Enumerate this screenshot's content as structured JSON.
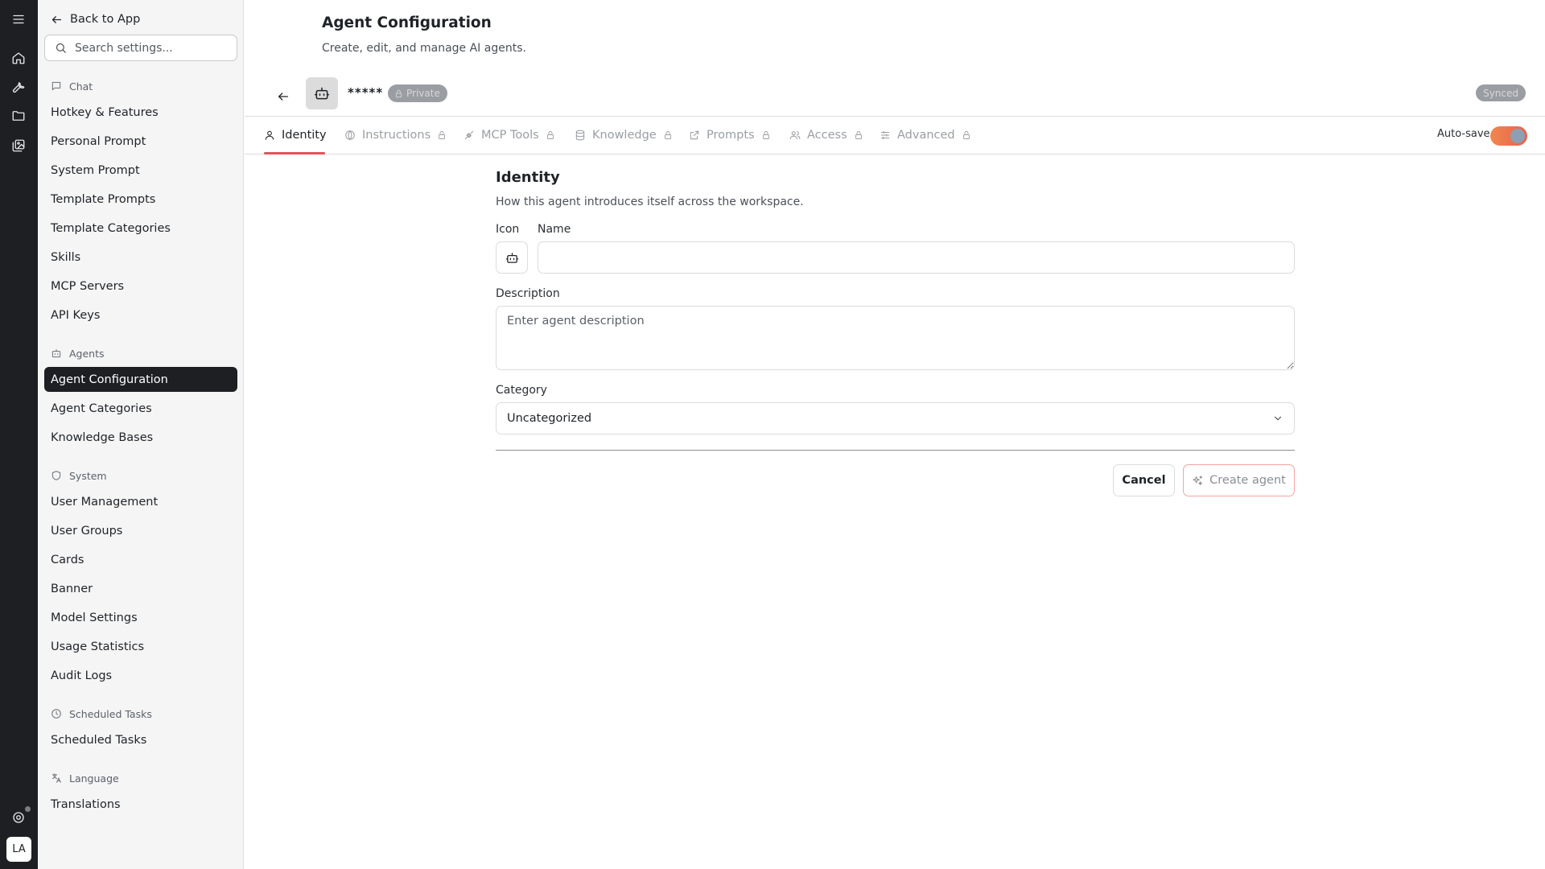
{
  "rail": {
    "items": [
      {
        "icon": "menu-icon"
      },
      {
        "icon": "home-icon"
      },
      {
        "icon": "wrench-icon"
      },
      {
        "icon": "folder-icon"
      },
      {
        "icon": "gallery-icon"
      }
    ],
    "bottom_icon": "support-icon",
    "avatar_initials": "LA"
  },
  "sidebar": {
    "back_label": "Back to App",
    "search_placeholder": "Search settings...",
    "groups": [
      {
        "label": "Chat",
        "icon": "chat-icon",
        "items": [
          "Hotkey & Features",
          "Personal Prompt",
          "System Prompt",
          "Template Prompts",
          "Template Categories",
          "Skills",
          "MCP Servers",
          "API Keys"
        ]
      },
      {
        "label": "Agents",
        "icon": "bot-icon",
        "items": [
          "Agent Configuration",
          "Agent Categories",
          "Knowledge Bases"
        ]
      },
      {
        "label": "System",
        "icon": "shield-icon",
        "items": [
          "User Management",
          "User Groups",
          "Cards",
          "Banner",
          "Model Settings",
          "Usage Statistics",
          "Audit Logs"
        ]
      },
      {
        "label": "Scheduled Tasks",
        "icon": "clock-icon",
        "items": [
          "Scheduled Tasks"
        ]
      },
      {
        "label": "Language",
        "icon": "translate-icon",
        "items": [
          "Translations"
        ]
      }
    ],
    "active_item": "Agent Configuration"
  },
  "header": {
    "title": "Agent Configuration",
    "subtitle": "Create, edit, and manage AI agents."
  },
  "agent_bar": {
    "name": "*****",
    "visibility_badge": "Private",
    "sync_status": "Synced"
  },
  "tabs": {
    "items": [
      {
        "label": "Identity",
        "icon": "user-icon",
        "locked": false,
        "active": true
      },
      {
        "label": "Instructions",
        "icon": "globe-icon",
        "locked": true,
        "active": false
      },
      {
        "label": "MCP Tools",
        "icon": "plug-icon",
        "locked": true,
        "active": false
      },
      {
        "label": "Knowledge",
        "icon": "database-icon",
        "locked": true,
        "active": false
      },
      {
        "label": "Prompts",
        "icon": "share-icon",
        "locked": true,
        "active": false
      },
      {
        "label": "Access",
        "icon": "users-icon",
        "locked": true,
        "active": false
      },
      {
        "label": "Advanced",
        "icon": "sliders-icon",
        "locked": true,
        "active": false
      }
    ],
    "autosave_label": "Auto-save",
    "autosave_on": true
  },
  "identity": {
    "title": "Identity",
    "description": "How this agent introduces itself across the workspace.",
    "icon_label": "Icon",
    "name_label": "Name",
    "name_value": "",
    "description_label": "Description",
    "description_placeholder": "Enter agent description",
    "category_label": "Category",
    "category_value": "Uncategorized",
    "cancel_label": "Cancel",
    "create_label": "Create agent"
  },
  "colors": {
    "rail_bg": "#1d1f22",
    "active_nav_bg": "#1d1f22",
    "tab_accent": "#e0545f",
    "toggle_on": "#e8624f"
  }
}
